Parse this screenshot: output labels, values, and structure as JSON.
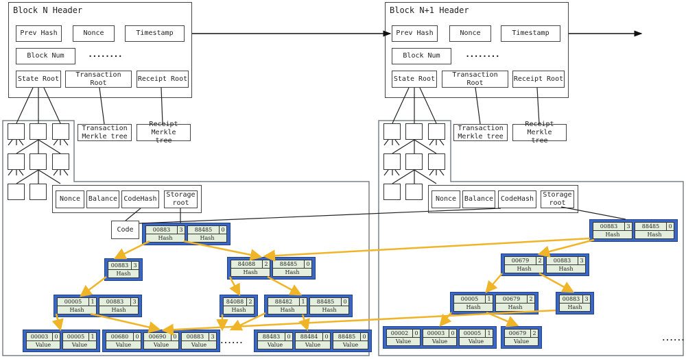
{
  "blocks": [
    {
      "title": "Block N Header",
      "fields": {
        "prev_hash": "Prev Hash",
        "nonce": "Nonce",
        "timestamp": "Timestamp",
        "block_num": "Block Num",
        "ellipsis": "········",
        "state_root": "State Root",
        "transaction_root": "Transaction Root",
        "receipt_root": "Receipt Root"
      },
      "transaction_tree": "Transaction Merkle tree",
      "receipt_tree": "Receipt Merkle tree",
      "account": {
        "nonce": "Nonce",
        "balance": "Balance",
        "code_hash": "CodeHash",
        "storage_root": "Storage root"
      },
      "code": "Code",
      "storage_trie": {
        "root": [
          {
            "key": "00883",
            "idx": "3",
            "label": "Hash"
          },
          {
            "key": "88485",
            "idx": "0",
            "label": "Hash"
          }
        ],
        "l1a": [
          {
            "key": "00883",
            "idx": "3",
            "label": "Hash"
          }
        ],
        "l1b": [
          {
            "key": "84088",
            "idx": "2",
            "label": "Hash"
          },
          {
            "key": "88485",
            "idx": "0",
            "label": "Hash"
          }
        ],
        "l2a": [
          {
            "key": "00005",
            "idx": "1",
            "label": "Hash"
          },
          {
            "key": "00883",
            "idx": "3",
            "label": "Hash"
          }
        ],
        "l2b": [
          {
            "key": "84088",
            "idx": "2",
            "label": "Hash"
          }
        ],
        "l2c": [
          {
            "key": "88482",
            "idx": "1",
            "label": "Hash"
          },
          {
            "key": "88485",
            "idx": "0",
            "label": "Hash"
          }
        ],
        "leaf1": [
          {
            "key": "00003",
            "idx": "0",
            "label": "Value"
          },
          {
            "key": "00005",
            "idx": "1",
            "label": "Value"
          }
        ],
        "leaf2": [
          {
            "key": "00680",
            "idx": "0",
            "label": "Value"
          },
          {
            "key": "00690",
            "idx": "0",
            "label": "Value"
          },
          {
            "key": "00883",
            "idx": "3",
            "label": "Value"
          }
        ],
        "leaf3": [
          {
            "key": "88483",
            "idx": "0",
            "label": "Value"
          },
          {
            "key": "88484",
            "idx": "0",
            "label": "Value"
          },
          {
            "key": "88485",
            "idx": "0",
            "label": "Value"
          }
        ],
        "ellipsis": "······"
      }
    },
    {
      "title": "Block N+1 Header",
      "fields": {
        "prev_hash": "Prev Hash",
        "nonce": "Nonce",
        "timestamp": "Timestamp",
        "block_num": "Block Num",
        "ellipsis": "········",
        "state_root": "State Root",
        "transaction_root": "Transaction Root",
        "receipt_root": "Receipt Root"
      },
      "transaction_tree": "Transaction Merkle tree",
      "receipt_tree": "Receipt Merkle tree",
      "account": {
        "nonce": "Nonce",
        "balance": "Balance",
        "code_hash": "CodeHash",
        "storage_root": "Storage root"
      },
      "storage_trie": {
        "root": [
          {
            "key": "00883",
            "idx": "3",
            "label": "Hash"
          },
          {
            "key": "88485",
            "idx": "0",
            "label": "Hash"
          }
        ],
        "l1": [
          {
            "key": "00679",
            "idx": "2",
            "label": "Hash"
          },
          {
            "key": "00883",
            "idx": "3",
            "label": "Hash"
          }
        ],
        "l2a": [
          {
            "key": "00005",
            "idx": "1",
            "label": "Hash"
          },
          {
            "key": "00679",
            "idx": "2",
            "label": "Hash"
          }
        ],
        "l2b": [
          {
            "key": "00883",
            "idx": "3",
            "label": "Hash"
          }
        ],
        "leaf1": [
          {
            "key": "00002",
            "idx": "0",
            "label": "Value"
          },
          {
            "key": "00003",
            "idx": "0",
            "label": "Value"
          },
          {
            "key": "00005",
            "idx": "1",
            "label": "Value"
          }
        ],
        "leaf2": [
          {
            "key": "00679",
            "idx": "2",
            "label": "Value"
          }
        ],
        "ellipsis": "······"
      }
    }
  ],
  "colors": {
    "node_fill": "#3a66c4",
    "cell_fill": "#e4eedd",
    "arrow": "#f0b428",
    "panel_border": "#7a8088"
  }
}
